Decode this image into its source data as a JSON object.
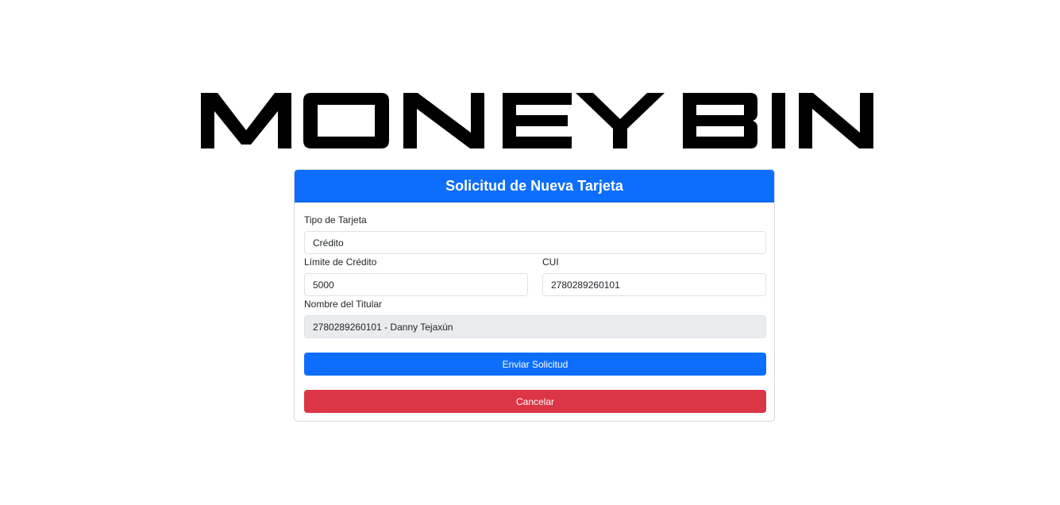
{
  "logo": {
    "text": "MONEY BIN"
  },
  "form": {
    "title": "Solicitud de Nueva Tarjeta",
    "card_type_label": "Tipo de Tarjeta",
    "card_type_value": "Crédito",
    "credit_limit_label": "Límite de Crédito",
    "credit_limit_value": "5000",
    "cui_label": "CUI",
    "cui_value": "2780289260101",
    "holder_label": "Nombre del Titular",
    "holder_value": "2780289260101 - Danny Tejaxún",
    "submit_label": "Enviar Solicitud",
    "cancel_label": "Cancelar"
  },
  "colors": {
    "primary": "#0d6efd",
    "danger": "#dc3545",
    "disabled_bg": "#e9ecef"
  }
}
